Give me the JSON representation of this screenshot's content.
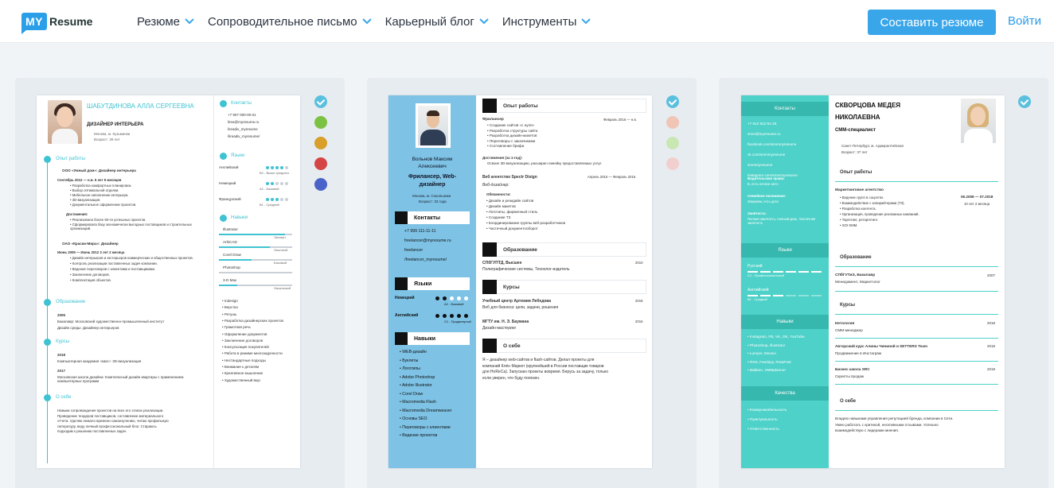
{
  "header": {
    "logo_my": "MY",
    "logo_resume": "Resume",
    "nav": [
      "Резюме",
      "Сопроводительное письмо",
      "Карьерный блог",
      "Инструменты"
    ],
    "create_button": "Составить резюме",
    "login": "Войти"
  },
  "colors": {
    "accent": "#3aa6ea",
    "teal": "#3fc3d3",
    "sky": "#7ec3e6",
    "mint": "#4dd1c8"
  },
  "card1": {
    "swatches": [
      "#5bc0de",
      "#7cc242",
      "#d89f2a",
      "#d64545",
      "#4a63c8"
    ],
    "name": "ШАБУТДИНОВА АЛЛА СЕРГЕЕВНА",
    "title": "ДИЗАЙНЕР ИНТЕРЬЕРА",
    "city": "Москва, м. Кузьминки",
    "age": "Возраст: 39 лет",
    "experience_title": "Опыт работы",
    "job1_company": "ООО «Умный дом»: Дизайнер интерьера",
    "job1_period": "Сентябрь 2012 — н.в. 5 лет 9 месяцев",
    "job1_items": [
      "Разработка комфортных планировок.",
      "Выбор оптимальной отделки.",
      "Мебельное наполнение интерьера.",
      "3D-визуализация.",
      "Документальное оформление проектов."
    ],
    "job1_ach": "Достижения:",
    "job1_ach_items": [
      "Реализовала более 50-ти успешных проектов.",
      "Сформировала базу экономически выгодных поставщиков и строительных организаций."
    ],
    "job2_company": "ОАО «Краски-Мира»: Дизайнер",
    "job2_period": "Июнь 2009 — Июнь 2012 3 лет 2 месяца",
    "job2_items": [
      "Дизайн интерьеров и экстерьеров коммерческих и общественных проектов.",
      "Контроль реализации поставленных задач компании.",
      "Ведение переговоров с клиентами и поставщиками.",
      "Заключение договоров.",
      "Комплектация объектов."
    ],
    "edu_title": "Образование",
    "edu_year": "2005",
    "edu_line1": "Бакалавр: Московский художественно-промышленный институт",
    "edu_line2": "Дизайн среды: Дизайнер интерьеров",
    "courses_title": "Курсы",
    "course1_year": "2018",
    "course1": "Компьютерная академия «Шаг»: 3D-визуализация",
    "course2_year": "2017",
    "course2": "Московская школа дизайна: Комплексный дизайн квартиры с применением компьютерных программ",
    "about_title": "О себе",
    "about_text": [
      "Навыки сопровождения проектов на всех его этапах реализации.",
      "Проведение тендеров поставщиков, составление материального",
      "отчета. Уделяю немало времени самоизучению, читаю профильную",
      "литературу, веду личный профессиональный блог. Стараюсь",
      "подходим к решению поставленных задач."
    ],
    "contacts_title": "Контакты",
    "contacts": [
      "+7 907 000-00-01",
      "lirea@myresume.ru",
      "lireadiv_myresume",
      "/lireadiv_myresume/"
    ],
    "langs_title": "Языки",
    "langs": [
      {
        "name": "Английский",
        "level": "B2 - Выше среднего",
        "value": 4
      },
      {
        "name": "Немецкий",
        "level": "A2 - Базовый",
        "value": 2
      },
      {
        "name": "Французский",
        "level": "B1 - Средний",
        "value": 3
      }
    ],
    "skills_title": "Навыки",
    "skills_bars": [
      {
        "name": "Illustrator",
        "level": "Эксперт",
        "value": 0.9
      },
      {
        "name": "ArhiCAD",
        "level": "Опытный",
        "value": 0.7
      },
      {
        "name": "Corel Draw",
        "level": "Базовый",
        "value": 0.45
      },
      {
        "name": "Photoshop",
        "level": "",
        "value": 0
      },
      {
        "name": "3-D Max",
        "level": "Начальный",
        "value": 0.25
      }
    ],
    "skills_list": [
      "Indesign",
      "Верстка",
      "Ретушь",
      "Разработка дизайнерских проектов",
      "Грамотная речь",
      "Оформление документов",
      "Заключение договоров",
      "Консультация покупателей",
      "Работа в режиме многозадачности",
      "Нестандартные подходы",
      "Внимание к деталям",
      "Креативное мышление",
      "Художественный вкус"
    ]
  },
  "card2": {
    "swatches": [
      "#5bc0de",
      "#f0c5b5",
      "#c9e7b3",
      "#f2cfcf"
    ],
    "name": "Вольнов Максим Алексеевич",
    "title": "Фрилансер, Web-дизайнер",
    "city": "Москва, м. Сокольники",
    "age": "Возраст: 33 года",
    "contacts_title": "Контакты",
    "contacts": [
      "+7 999 111-11-11",
      "freelancer@myresume.ru",
      "freelancer",
      "/freelancer_myresume/"
    ],
    "langs_title": "Языки",
    "langs": [
      {
        "name": "Немецкий",
        "level": "A2 - Базовый",
        "value": 2
      },
      {
        "name": "Английский",
        "level": "C1 - Продвинутый",
        "value": 5
      }
    ],
    "skills_title": "Навыки",
    "skills": [
      "WEB-дизайн",
      "Буклеты",
      "Логотипы",
      "Adobe Photoshop",
      "Adobe Illustrator",
      "Corel Draw",
      "Macromedia Flash",
      "Macromedia Dreamweaver",
      "Основы SEO",
      "Переговоры с клиентами",
      "Ведение проектов"
    ],
    "experience_title": "Опыт работы",
    "job1_title": "Фрилансер",
    "job1_period": "Февраль 2016 — н.в.",
    "job1_items": [
      "Создание сайтов «с нуля»",
      "Разработка структуры сайта",
      "Разработка дизайн-макетов",
      "Переговоры с заказчиками",
      "Составление брифа"
    ],
    "job1_ach": "Достижения (за 1-год):",
    "job1_ach_item": "Освоил 3D-визуализацию, расширил линейку предоставляемых услуг.",
    "job2_company": "Веб агентство Spectr Disign",
    "job2_period": "Апрель 2015 — Февраль 2016",
    "job2_role": "Веб-дизайнер:",
    "job2_duties": "Обязанности:",
    "job2_items": [
      "Дизайн и резидайн сайтов",
      "Дизайн макетов",
      "Логотипы, фирменный стиль",
      "Создание ТЗ",
      "Координирование группы веб-разработчиков",
      "Частичный документооборот"
    ],
    "edu_title": "Образование",
    "edu_school": "СПбГУПТД, Высшее",
    "edu_year": "2010",
    "edu_text": "Полиграфические системы, Технолог-издатель",
    "courses_title": "Курсы",
    "course1": "Учебный центр Артемия Лебедева",
    "course1_year": "2018",
    "course1_text": "Веб для бизнеса: цели, задачи, решения",
    "course2": "МГТУ им. Н. Э. Баумана",
    "course2_year": "2016",
    "course2_text": "Дизайн-мастеринг",
    "about_title": "О себе",
    "about_text": [
      "Я – дизайнер web-сайтов и flash-сайтов. Делал проекты для",
      "компаний Клён Маркет (крупнейший в России поставщик товаров",
      "для HoReCa). Запускаю проекты вовремя. Берусь за задачу, только",
      "если уверен, что буду полезен."
    ]
  },
  "card3": {
    "swatches": [
      "#5bc0de"
    ],
    "name_line1": "СКВОРЦОВА МЕДЕЯ",
    "name_line2": "НИКОЛАЕВНА",
    "title": "СММ-специалист",
    "city": "Санкт-Петербург, м. Адмиралтейская",
    "age": "Возраст: 37 лет",
    "contacts_title": "Контакты",
    "contacts": [
      "+7 812 812-81-28",
      "smm@myresume.ru",
      "facebook.com/smmmyresume",
      "vk.com/smmmyresume",
      "smmmyresume",
      "instagram.com/smmmyresume"
    ],
    "info": [
      {
        "label": "Водительские права:",
        "value": "B, есть личное авто"
      },
      {
        "label": "Семейное положение:",
        "value": "Замужем, есть дети"
      },
      {
        "label": "Занятость:",
        "value": "Полная занятость, полный день, Частичная занятость"
      }
    ],
    "langs_title": "Языки",
    "langs": [
      {
        "name": "Русский",
        "level": "C2 - Профессиональный",
        "value": 6
      },
      {
        "name": "Английский",
        "level": "B1 - Средний",
        "value": 3
      }
    ],
    "skills_title": "Навыки",
    "skills": [
      "Instagram, FB, VK, OK, YouTube",
      "Photoshop, Illustrator",
      "Lumyer, Movavi",
      "RSS, Feedspy, RotaPost",
      "Babkee, SMMplanner"
    ],
    "qual_title": "Качества",
    "qual": [
      "Коммуникабельность",
      "Пунктуальность",
      "Ответственность"
    ],
    "experience_title": "Опыт работы",
    "job_company": "Маркетинговое агентство",
    "job_period": "06.2008 — 07.2018",
    "job_duration": "10 лет 2 месяца",
    "job_items": [
      "Ведение групп в соцсетях.",
      "Взаимодействие с копирайтерами (ТЗ).",
      "Разработка контента.",
      "Организация, проведение рекламных кампаний.",
      "Таргетинг, ретаргетинг.",
      "SOI SMM."
    ],
    "edu_title": "Образование",
    "edu_school": "СПбГУТиЭ, Бакалавр",
    "edu_year": "2007",
    "edu_text": "Менеджмент, Маркетолог",
    "courses_title": "Курсы",
    "courses": [
      {
        "name": "Нетология",
        "year": "2018",
        "text": "СММ-менеджер"
      },
      {
        "name": "Авторский курс Алины Чининой и SETTERS Team",
        "year": "2018",
        "text": "Продвижение в Инстаграм"
      },
      {
        "name": "Бизнес школа SRC",
        "year": "2018",
        "text": "Скрипты продаж"
      }
    ],
    "about_title": "О себе",
    "about_text": [
      "Владею навыками управления репутацией бренда, компании в Сети.",
      "Умею работать с критикой, негативными отзывами. Успешно",
      "взаимодействую с лидерами мнения."
    ]
  }
}
